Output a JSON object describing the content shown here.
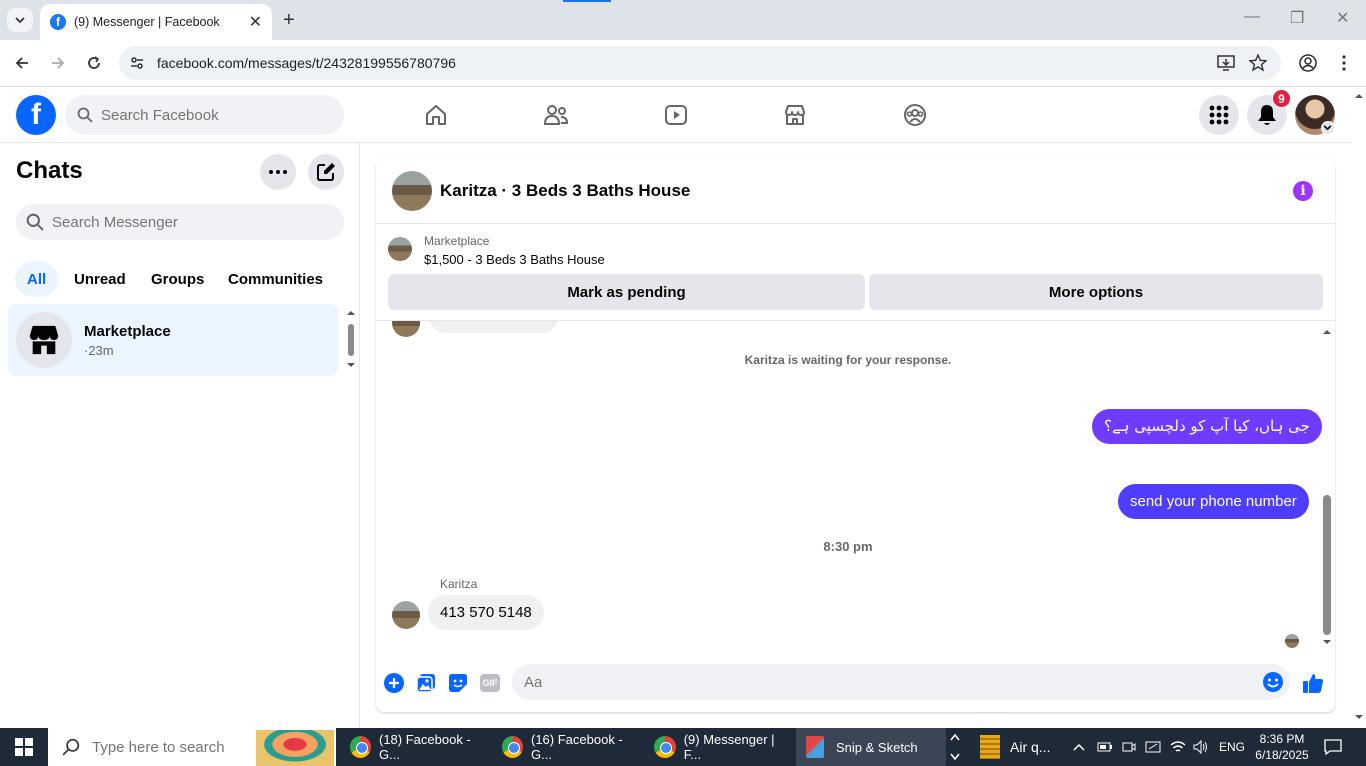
{
  "browser": {
    "tab_title": "(9) Messenger | Facebook",
    "tab_favicon": "f",
    "url": "facebook.com/messages/t/24328199556780796"
  },
  "fb": {
    "search_placeholder": "Search Facebook",
    "notification_count": "9",
    "brand_color": "#0866ff",
    "logo_letter": "f"
  },
  "sidebar": {
    "title": "Chats",
    "search_placeholder": "Search Messenger",
    "filters": [
      "All",
      "Unread",
      "Groups",
      "Communities"
    ],
    "active_filter": "All",
    "chats": [
      {
        "name": "Marketplace",
        "time": "·23m"
      }
    ]
  },
  "conversation": {
    "title": "Karitza · 3 Beds 3 Baths House",
    "marketplace_label": "Marketplace",
    "listing": "$1,500 - 3 Beds 3 Baths House",
    "btn_pending": "Mark as pending",
    "btn_more": "More options",
    "info_glyph": "i",
    "system_notice": "Karitza is waiting for your response.",
    "msg_urdu": "جی ہاں، کیا آپ کو دلچسپی ہے؟",
    "msg_phone_request": "send your phone number",
    "timestamp": "8:30 pm",
    "sender_name": "Karitza",
    "msg_reply": "413 570 5148",
    "composer_placeholder": "Aa",
    "gif_label": "GIF",
    "accent_color": "#0866ff"
  },
  "taskbar": {
    "search_placeholder": "Type here to search",
    "apps": [
      {
        "label": "(18) Facebook - G..."
      },
      {
        "label": "(16) Facebook - G..."
      },
      {
        "label": "(9) Messenger | F..."
      },
      {
        "label": "Snip & Sketch"
      }
    ],
    "weather": "Air q...",
    "lang": "ENG",
    "time": "8:36 PM",
    "date": "6/18/2025"
  }
}
